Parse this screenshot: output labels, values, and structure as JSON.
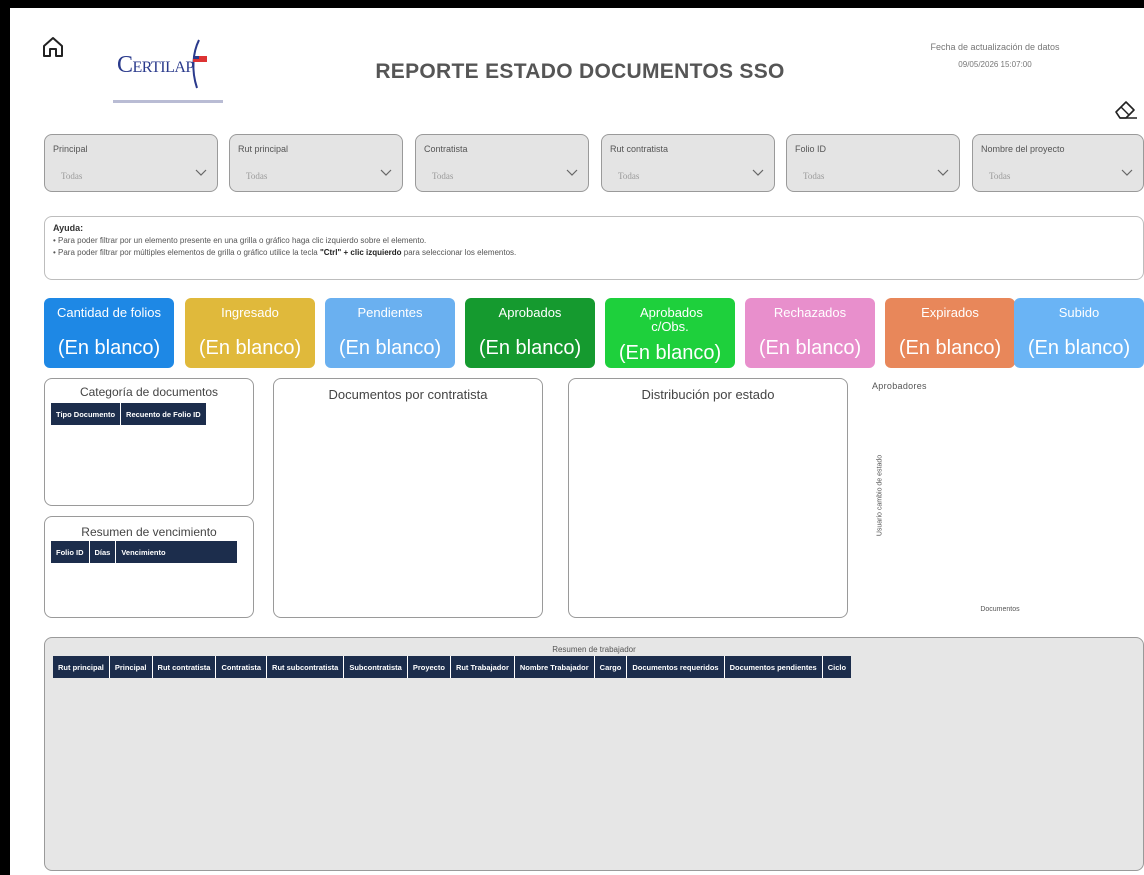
{
  "header": {
    "title": "REPORTE ESTADO DOCUMENTOS SSO",
    "date_label": "Fecha de actualización de datos",
    "date_value": "09/05/2026 15:07:00",
    "logo_text": "CERTILAP CHILE"
  },
  "filters": [
    {
      "label": "Principal",
      "value": "Todas"
    },
    {
      "label": "Rut principal",
      "value": "Todas"
    },
    {
      "label": "Contratista",
      "value": "Todas"
    },
    {
      "label": "Rut contratista",
      "value": "Todas"
    },
    {
      "label": "Folio ID",
      "value": "Todas"
    },
    {
      "label": "Nombre del proyecto",
      "value": "Todas"
    }
  ],
  "help": {
    "title": "Ayuda:",
    "line1": "• Para poder filtrar por un elemento presente en una grilla o gráfico haga clic izquierdo sobre el elemento.",
    "line2_pre": "• Para poder filtrar por múltiples elementos de grilla o gráfico utilice la tecla ",
    "line2_key": "\"Ctrl\" + clic izquierdo",
    "line2_post": " para seleccionar los elementos."
  },
  "cards": [
    {
      "label": "Cantidad de folios",
      "value": "(En blanco)",
      "color": "#1e88e5"
    },
    {
      "label": "Ingresado",
      "value": "(En blanco)",
      "color": "#e0b93b"
    },
    {
      "label": "Pendientes",
      "value": "(En blanco)",
      "color": "#6ab0f0"
    },
    {
      "label": "Aprobados",
      "value": "(En blanco)",
      "color": "#159a2f"
    },
    {
      "label": "Aprobados c/Obs.",
      "value": "(En blanco)",
      "color": "#1ed03c"
    },
    {
      "label": "Rechazados",
      "value": "(En blanco)",
      "color": "#e88fcc"
    },
    {
      "label": "Expirados",
      "value": "(En blanco)",
      "color": "#e8875a"
    },
    {
      "label": "Subido",
      "value": "(En blanco)",
      "color": "#6ab4f5"
    }
  ],
  "panels": {
    "categoria": {
      "title": "Categoría de documentos",
      "columns": [
        "Tipo Documento",
        "Recuento de Folio ID"
      ]
    },
    "vencimiento": {
      "title": "Resumen de vencimiento",
      "columns": [
        "Folio ID",
        "Días",
        "Vencimiento"
      ]
    },
    "contratista": {
      "title": "Documentos por contratista"
    },
    "distribucion": {
      "title": "Distribución por estado"
    },
    "aprobadores": {
      "title": "Aprobadores",
      "ylabel": "Usuario cambio de estado",
      "xlabel": "Documentos"
    }
  },
  "summary": {
    "title": "Resumen de trabajador",
    "columns": [
      "Rut principal",
      "Principal",
      "Rut contratista",
      "Contratista",
      "Rut subcontratista",
      "Subcontratista",
      "Proyecto",
      "Rut Trabajador",
      "Nombre Trabajador",
      "Cargo",
      "Documentos requeridos",
      "Documentos pendientes",
      "Ciclo"
    ]
  }
}
